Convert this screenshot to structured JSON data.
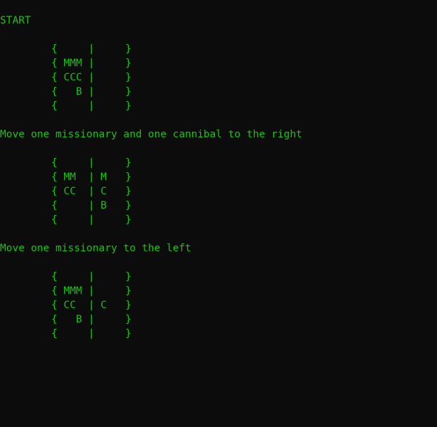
{
  "console": {
    "start_heading": "START",
    "state_1": [
      "{     |     }",
      "{ MMM |     }",
      "{ CCC |     }",
      "{   B |     }",
      "{     |     }"
    ],
    "move_1": "Move one missionary and one cannibal to the right",
    "state_2": [
      "{     |     }",
      "{ MM  | M   }",
      "{ CC  | C   }",
      "{     | B   }",
      "{     |     }"
    ],
    "move_2": "Move one missionary to the left",
    "state_3": [
      "{     |     }",
      "{ MMM |     }",
      "{ CC  | C   }",
      "{   B |     }",
      "{     |     }"
    ]
  },
  "colors": {
    "background": "#0c0c0c",
    "text": "#16c60c"
  }
}
